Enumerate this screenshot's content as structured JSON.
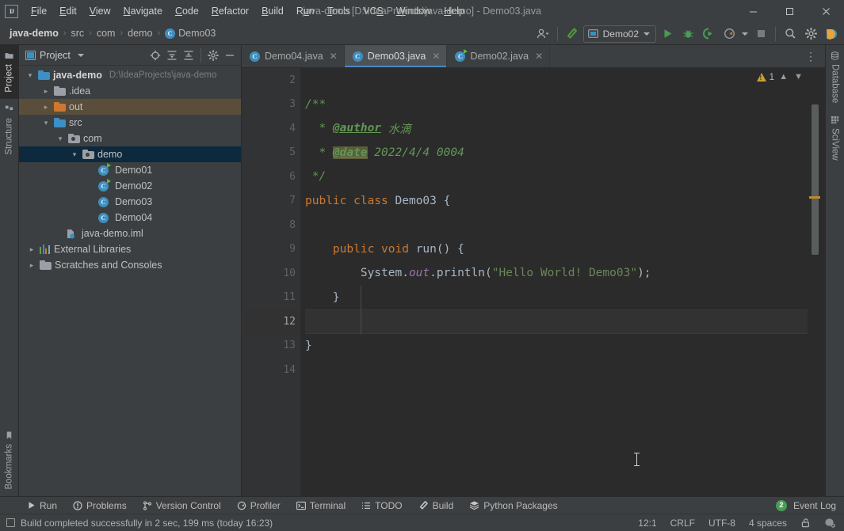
{
  "window": {
    "title": "java-demo [D:\\IdeaProjects\\java-demo] - Demo03.java",
    "minimize_label": "—",
    "maximize_label": "☐",
    "close_label": "✕",
    "logo_text": "IJ"
  },
  "menu": {
    "items": [
      {
        "label": "File",
        "accel": "F"
      },
      {
        "label": "Edit",
        "accel": "E"
      },
      {
        "label": "View",
        "accel": "V"
      },
      {
        "label": "Navigate",
        "accel": "N"
      },
      {
        "label": "Code",
        "accel": "C"
      },
      {
        "label": "Refactor",
        "accel": "R"
      },
      {
        "label": "Build",
        "accel": "B"
      },
      {
        "label": "Run",
        "accel": "u"
      },
      {
        "label": "Tools",
        "accel": "T"
      },
      {
        "label": "VCS",
        "accel": "S"
      },
      {
        "label": "Window",
        "accel": "W"
      },
      {
        "label": "Help",
        "accel": "H"
      }
    ]
  },
  "navbar": {
    "crumbs": [
      "java-demo",
      "src",
      "com",
      "demo"
    ],
    "crumb_separator": "›",
    "last_crumb": "Demo03",
    "last_crumb_icon": "java-class-icon"
  },
  "toolbar": {
    "user_icon": "user-account-icon",
    "build_icon": "build-hammer-icon",
    "run_config_name": "Demo02",
    "run_config_icon": "application-config-icon",
    "run_icon": "run-play-icon",
    "debug_icon": "debug-bug-icon",
    "run_coverage_icon": "run-with-coverage-icon",
    "profiler_icon": "profiler-icon",
    "stop_icon": "stop-square-icon",
    "search_icon": "search-everywhere-icon",
    "settings_icon": "settings-gear-icon",
    "updates_icon": "ide-updates-icon"
  },
  "left_strip": {
    "top_tabs": [
      {
        "label": "Project",
        "icon": "project-folder-icon",
        "active": true
      },
      {
        "label": "Structure",
        "icon": "structure-icon",
        "active": false
      }
    ],
    "bottom_tabs": [
      {
        "label": "Bookmarks",
        "icon": "bookmarks-icon",
        "active": false
      }
    ]
  },
  "right_strip": {
    "tabs": [
      {
        "label": "Database",
        "icon": "database-icon"
      },
      {
        "label": "SciView",
        "icon": "sciview-grid-icon"
      }
    ]
  },
  "project_panel": {
    "title": "Project",
    "title_icon": "project-view-icon",
    "dropdown_icon": "chevron-down-icon",
    "tools": [
      {
        "name": "select-opened-file-icon",
        "label": "Select Opened File"
      },
      {
        "name": "expand-all-icon",
        "label": "Expand All"
      },
      {
        "name": "collapse-all-icon",
        "label": "Collapse All"
      },
      {
        "name": "settings-gear-icon",
        "label": "Options"
      },
      {
        "name": "hide-icon",
        "label": "Hide"
      }
    ],
    "tree": [
      {
        "label": "java-demo",
        "path": "D:\\IdeaProjects\\java-demo",
        "indent": 0,
        "arrow": "expanded",
        "icon": "module-folder-icon",
        "bold": true,
        "state": "normal"
      },
      {
        "label": ".idea",
        "path": "",
        "indent": 1,
        "arrow": "collapsed",
        "icon": "folder-gray-icon",
        "bold": false,
        "state": "normal"
      },
      {
        "label": "out",
        "path": "",
        "indent": 1,
        "arrow": "collapsed",
        "icon": "folder-orange-icon",
        "bold": false,
        "state": "excluded"
      },
      {
        "label": "src",
        "path": "",
        "indent": 1,
        "arrow": "expanded",
        "icon": "source-folder-icon",
        "bold": false,
        "state": "normal"
      },
      {
        "label": "com",
        "path": "",
        "indent": 2,
        "arrow": "expanded",
        "icon": "package-icon",
        "bold": false,
        "state": "normal"
      },
      {
        "label": "demo",
        "path": "",
        "indent": 3,
        "arrow": "expanded",
        "icon": "package-icon",
        "bold": false,
        "state": "selected"
      },
      {
        "label": "Demo01",
        "path": "",
        "indent": 4,
        "arrow": "none",
        "icon": "java-class-runnable-icon",
        "bold": false,
        "state": "normal"
      },
      {
        "label": "Demo02",
        "path": "",
        "indent": 4,
        "arrow": "none",
        "icon": "java-class-runnable-icon",
        "bold": false,
        "state": "normal"
      },
      {
        "label": "Demo03",
        "path": "",
        "indent": 4,
        "arrow": "none",
        "icon": "java-class-icon",
        "bold": false,
        "state": "normal"
      },
      {
        "label": "Demo04",
        "path": "",
        "indent": 4,
        "arrow": "none",
        "icon": "java-class-icon",
        "bold": false,
        "state": "normal"
      },
      {
        "label": "java-demo.iml",
        "path": "",
        "indent": 2,
        "arrow": "none",
        "icon": "iml-file-icon",
        "bold": false,
        "state": "normal"
      },
      {
        "label": "External Libraries",
        "path": "",
        "indent": 0,
        "arrow": "collapsed",
        "icon": "libraries-icon",
        "bold": false,
        "state": "normal"
      },
      {
        "label": "Scratches and Consoles",
        "path": "",
        "indent": 0,
        "arrow": "collapsed",
        "icon": "scratches-icon",
        "bold": false,
        "state": "normal"
      }
    ]
  },
  "editor": {
    "tabs": [
      {
        "label": "Demo04.java",
        "icon": "java-class-icon",
        "active": false,
        "close_label": "✕"
      },
      {
        "label": "Demo03.java",
        "icon": "java-class-icon",
        "active": true,
        "close_label": "✕"
      },
      {
        "label": "Demo02.java",
        "icon": "java-class-runnable-icon",
        "active": false,
        "close_label": "✕"
      }
    ],
    "tab_overflow_icon": "more-options-icon",
    "inspection": {
      "warning_icon": "warning-triangle-icon",
      "warning_count": "1",
      "prev_icon": "chevron-up-icon",
      "next_icon": "chevron-down-icon"
    },
    "first_visible_line": 2,
    "current_line": 12,
    "lines": [
      {
        "num": "2",
        "fold": "none",
        "segments": []
      },
      {
        "num": "3",
        "fold": "down",
        "segments": [
          {
            "t": "/**",
            "c": "cmt"
          }
        ]
      },
      {
        "num": "4",
        "fold": "none",
        "segments": [
          {
            "t": "  * ",
            "c": "cmt"
          },
          {
            "t": "@author",
            "c": "tag"
          },
          {
            "t": " 水滴",
            "c": "cmt"
          }
        ]
      },
      {
        "num": "5",
        "fold": "none",
        "segments": [
          {
            "t": "  * ",
            "c": "cmt"
          },
          {
            "t": "@date",
            "c": "tag-hl"
          },
          {
            "t": " 2022/4/4 0004",
            "c": "cmt"
          }
        ]
      },
      {
        "num": "6",
        "fold": "up",
        "segments": [
          {
            "t": " */",
            "c": "cmt"
          }
        ]
      },
      {
        "num": "7",
        "fold": "none",
        "segments": [
          {
            "t": "public ",
            "c": "kw"
          },
          {
            "t": "class ",
            "c": "kw"
          },
          {
            "t": "Demo03 {",
            "c": "cls"
          }
        ]
      },
      {
        "num": "8",
        "fold": "none",
        "segments": []
      },
      {
        "num": "9",
        "fold": "down",
        "segments": [
          {
            "t": "    ",
            "c": "plain"
          },
          {
            "t": "public ",
            "c": "kw"
          },
          {
            "t": "void ",
            "c": "kw"
          },
          {
            "t": "run() {",
            "c": "cls"
          }
        ]
      },
      {
        "num": "10",
        "fold": "none",
        "segments": [
          {
            "t": "        System.",
            "c": "plain"
          },
          {
            "t": "out",
            "c": "field"
          },
          {
            "t": ".println(",
            "c": "plain"
          },
          {
            "t": "\"Hello World! Demo03\"",
            "c": "str"
          },
          {
            "t": ");",
            "c": "plain"
          }
        ]
      },
      {
        "num": "11",
        "fold": "up",
        "segments": [
          {
            "t": "    }",
            "c": "plain"
          }
        ]
      },
      {
        "num": "12",
        "fold": "none",
        "segments": []
      },
      {
        "num": "13",
        "fold": "none",
        "segments": [
          {
            "t": "}",
            "c": "plain"
          }
        ]
      },
      {
        "num": "14",
        "fold": "none",
        "segments": []
      }
    ]
  },
  "bottom_bar": {
    "items": [
      {
        "label": "Run",
        "icon": "run-play-icon"
      },
      {
        "label": "Problems",
        "icon": "problems-icon"
      },
      {
        "label": "Version Control",
        "icon": "version-control-icon"
      },
      {
        "label": "Profiler",
        "icon": "profiler-icon"
      },
      {
        "label": "Terminal",
        "icon": "terminal-icon"
      },
      {
        "label": "TODO",
        "icon": "todo-list-icon"
      },
      {
        "label": "Build",
        "icon": "build-hammer-icon"
      },
      {
        "label": "Python Packages",
        "icon": "python-packages-icon"
      }
    ],
    "event_log": {
      "label": "Event Log",
      "count": "2"
    }
  },
  "status_bar": {
    "message": "Build completed successfully in 2 sec, 199 ms (today 16:23)",
    "message_icon": "build-status-icon",
    "caret_position": "12:1",
    "line_separator": "CRLF",
    "encoding": "UTF-8",
    "indent": "4 spaces",
    "lock_icon": "read-only-lock-icon",
    "inspection_icon": "inspection-profile-icon"
  },
  "colors": {
    "accent_blue": "#4a88c7",
    "run_green": "#499c54",
    "warning_orange": "#c9a038",
    "selection_blue": "#0d293e",
    "excluded_brown": "#5a4e3a",
    "string_green": "#6a8759",
    "keyword_orange": "#cc7832",
    "comment_green": "#629755",
    "editor_bg": "#2b2b2b",
    "panel_bg": "#3c3f41"
  }
}
